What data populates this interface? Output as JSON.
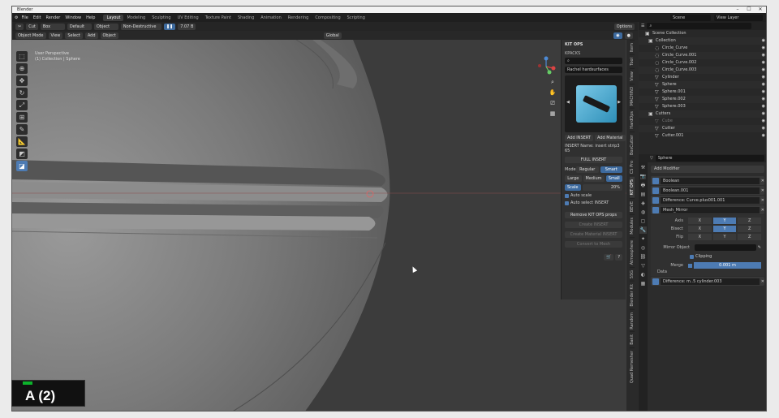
{
  "window": {
    "title": "Blender",
    "controls": [
      "–",
      "☐",
      "✕"
    ]
  },
  "topbar": {
    "menu": [
      "File",
      "Edit",
      "Render",
      "Window",
      "Help"
    ],
    "workspaces": [
      "Layout",
      "Modeling",
      "Sculpting",
      "UV Editing",
      "Texture Paint",
      "Shading",
      "Animation",
      "Rendering",
      "Compositing",
      "Scripting"
    ],
    "scene": "Scene",
    "view_layer": "View Layer"
  },
  "header2": {
    "tool": "Cut",
    "shape": "Box",
    "depth": "Default",
    "object": "Object",
    "mode": "Non-Destructive",
    "size": "7.07 B",
    "options": "Options"
  },
  "header3": {
    "mode": "Object Mode",
    "menus": [
      "View",
      "Select",
      "Add",
      "Object"
    ],
    "transform": "Global"
  },
  "viewport": {
    "view_name": "User Perspective",
    "collection": "(1) Collection | Sphere"
  },
  "npanel": {
    "title": "KIT OPS",
    "category": "KPACKS",
    "item": "Rachel hardsurfaces",
    "add_insert": "Add INSERT",
    "add_material": "Add Material",
    "insert_name": "INSERT Name: insert strip3 65",
    "full_button": "FULL INSERT",
    "mode_label": "Mode",
    "mode_options": [
      "Regular",
      "Smart"
    ],
    "size_options": [
      "Large",
      "Medium",
      "Small"
    ],
    "scale_label": "Scale",
    "scale_value": "20%",
    "auto_scale": "Auto scale",
    "auto_select": "Auto select INSERT",
    "remove_props": "Remove KIT OPS props",
    "create_insert": "Create INSERT",
    "create_mat": "Create Material INSERT",
    "convert": "Convert to Mesh"
  },
  "vtabs": [
    "Item",
    "Tool",
    "View",
    "MACHIN3",
    "HardOps",
    "BoxCutter",
    "CS Pro",
    "KIT OPS",
    "BEVE",
    "Modules",
    "Atmosphere",
    "SSG",
    "Blender Kit",
    "Random",
    "Bakit",
    "Quad Remesher"
  ],
  "outliner": {
    "header": "Scene Collection",
    "items": [
      {
        "label": "Collection",
        "icon": "▣",
        "dim": false
      },
      {
        "label": "Circle_Curve",
        "icon": "◌",
        "dim": false
      },
      {
        "label": "Circle_Curve.001",
        "icon": "◌",
        "dim": false
      },
      {
        "label": "Circle_Curve.002",
        "icon": "◌",
        "dim": false
      },
      {
        "label": "Circle_Curve.003",
        "icon": "◌",
        "dim": false
      },
      {
        "label": "Cylinder",
        "icon": "▽",
        "dim": false
      },
      {
        "label": "Sphere",
        "icon": "▽",
        "dim": false
      },
      {
        "label": "Sphere.001",
        "icon": "▽",
        "dim": false
      },
      {
        "label": "Sphere.002",
        "icon": "▽",
        "dim": false
      },
      {
        "label": "Sphere.003",
        "icon": "▽",
        "dim": false
      },
      {
        "label": "Cutters",
        "icon": "▣",
        "dim": false
      },
      {
        "label": "Cube",
        "icon": "▽",
        "dim": true
      },
      {
        "label": "Cutter",
        "icon": "▽",
        "dim": false
      },
      {
        "label": "Cutter.001",
        "icon": "▽",
        "dim": false
      }
    ]
  },
  "props": {
    "object": "Sphere",
    "add_modifier": "Add Modifier",
    "modifiers": [
      "Boolean",
      "Boolean.001",
      "Difference: Curve.plus001.001",
      "Mesh_Mirror",
      "Difference: m..5 cylinder.003"
    ],
    "axis_labels": [
      "Axis",
      "Bisect",
      "Flip"
    ],
    "axes": [
      "X",
      "Y",
      "Z"
    ],
    "mirror_object": "Mirror Object",
    "clipping": "Clipping",
    "merge": "Merge",
    "merge_value": "0.001 m",
    "data": "Data"
  },
  "badge": {
    "text": "A (2)"
  }
}
